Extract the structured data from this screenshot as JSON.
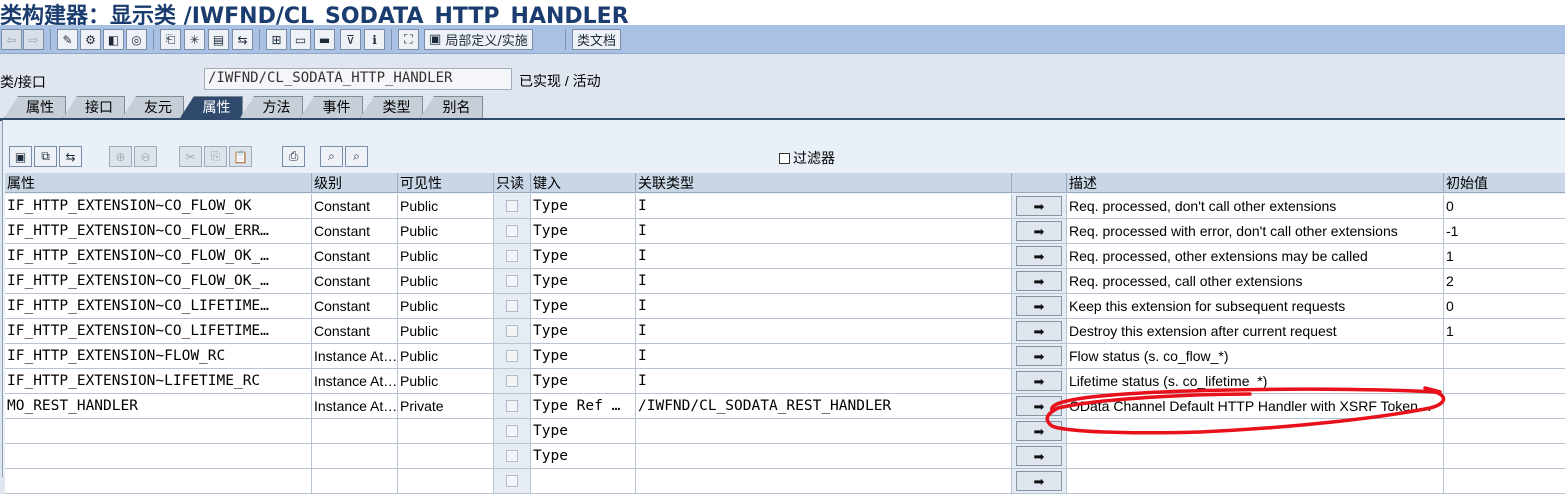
{
  "title": "类构建器：显示类 /IWFND/CL_SODATA_HTTP_HANDLER",
  "toolbar": {
    "local_def_label": "局部定义/实施",
    "class_doc_label": "类文档"
  },
  "class_field": {
    "label": "类/接口",
    "value": "/IWFND/CL_SODATA_HTTP_HANDLER",
    "status": "已实现 / 活动"
  },
  "tabs": [
    {
      "label": "属性"
    },
    {
      "label": "接口"
    },
    {
      "label": "友元"
    },
    {
      "label": "属性",
      "active": true
    },
    {
      "label": "方法"
    },
    {
      "label": "事件"
    },
    {
      "label": "类型"
    },
    {
      "label": "别名"
    }
  ],
  "filter_label": "过滤器",
  "columns": [
    "属性",
    "级别",
    "可见性",
    "只读",
    "键入",
    "关联类型",
    "",
    "描述",
    "初始值"
  ],
  "rows": [
    {
      "attr": "IF_HTTP_EXTENSION~CO_FLOW_OK",
      "level": "Constant",
      "vis": "Public",
      "typing": "Type",
      "assoc": "I",
      "desc": "Req. processed, don't call other extensions",
      "init": "0"
    },
    {
      "attr": "IF_HTTP_EXTENSION~CO_FLOW_ERR…",
      "level": "Constant",
      "vis": "Public",
      "typing": "Type",
      "assoc": "I",
      "desc": "Req. processed with error, don't call other extensions",
      "init": "-1"
    },
    {
      "attr": "IF_HTTP_EXTENSION~CO_FLOW_OK_…",
      "level": "Constant",
      "vis": "Public",
      "typing": "Type",
      "assoc": "I",
      "desc": "Req. processed, other extensions may be called",
      "init": "1"
    },
    {
      "attr": "IF_HTTP_EXTENSION~CO_FLOW_OK_…",
      "level": "Constant",
      "vis": "Public",
      "typing": "Type",
      "assoc": "I",
      "desc": "Req. processed, call other extensions",
      "init": "2"
    },
    {
      "attr": "IF_HTTP_EXTENSION~CO_LIFETIME…",
      "level": "Constant",
      "vis": "Public",
      "typing": "Type",
      "assoc": "I",
      "desc": "Keep this extension for subsequent requests",
      "init": "0"
    },
    {
      "attr": "IF_HTTP_EXTENSION~CO_LIFETIME…",
      "level": "Constant",
      "vis": "Public",
      "typing": "Type",
      "assoc": "I",
      "desc": "Destroy this extension after current request",
      "init": "1"
    },
    {
      "attr": "IF_HTTP_EXTENSION~FLOW_RC",
      "level": "Instance At…",
      "vis": "Public",
      "typing": "Type",
      "assoc": "I",
      "desc": "Flow status (s. co_flow_*)",
      "init": ""
    },
    {
      "attr": "IF_HTTP_EXTENSION~LIFETIME_RC",
      "level": "Instance At…",
      "vis": "Public",
      "typing": "Type",
      "assoc": "I",
      "desc": "Lifetime status (s. co_lifetime_*)",
      "init": ""
    },
    {
      "attr": "MO_REST_HANDLER",
      "level": "Instance At…",
      "vis": "Private",
      "typing": "Type Ref …",
      "assoc": "/IWFND/CL_SODATA_REST_HANDLER",
      "desc": "OData Channel Default HTTP Handler with XSRF Token…",
      "init": ""
    },
    {
      "attr": "",
      "level": "",
      "vis": "",
      "typing": "Type",
      "assoc": "",
      "desc": "",
      "init": ""
    },
    {
      "attr": "",
      "level": "",
      "vis": "",
      "typing": "Type",
      "assoc": "",
      "desc": "",
      "init": ""
    },
    {
      "attr": "",
      "level": "",
      "vis": "",
      "typing": "",
      "assoc": "",
      "desc": "",
      "init": ""
    }
  ],
  "colors": {
    "annotation": "#e8101a",
    "header_bg": "#c9d6e6",
    "tab_active": "#2f4a6c"
  }
}
